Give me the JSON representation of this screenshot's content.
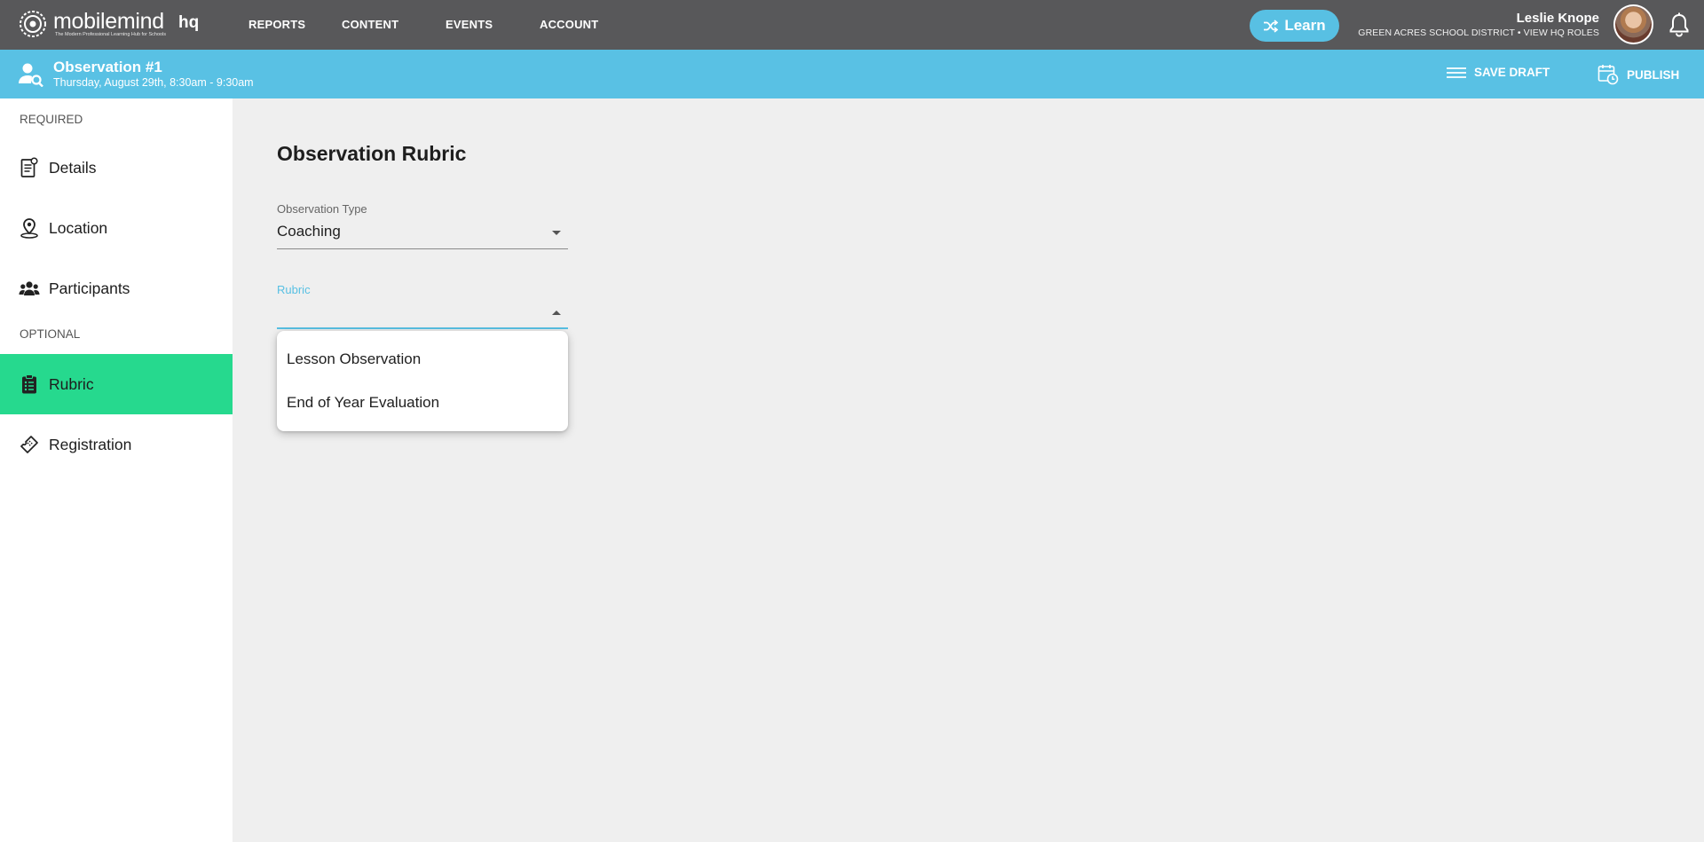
{
  "colors": {
    "topbar": "#58585a",
    "subbar": "#59c1e4",
    "accent_blue": "#58c0e3",
    "active_green": "#26d98e"
  },
  "brand": {
    "name_bold": "mobile",
    "name_light": "mind",
    "tagline": "The Modern Professional Learning Hub for Schools",
    "product": "hq"
  },
  "nav": {
    "items": [
      "REPORTS",
      "CONTENT",
      "EVENTS",
      "ACCOUNT"
    ]
  },
  "learn_button": {
    "label": "Learn",
    "icon": "shuffle-icon"
  },
  "user": {
    "name": "Leslie Knope",
    "subtitle": "GREEN ACRES SCHOOL DISTRICT • VIEW HQ ROLES"
  },
  "subheader": {
    "icon": "user-search-icon",
    "title": "Observation #1",
    "date": "Thursday, August 29th, 8:30am - 9:30am",
    "save_draft": "SAVE DRAFT",
    "publish": "PUBLISH"
  },
  "sidebar": {
    "required_label": "REQUIRED",
    "optional_label": "OPTIONAL",
    "items": [
      {
        "label": "Details",
        "icon": "document-icon"
      },
      {
        "label": "Location",
        "icon": "map-pin-icon"
      },
      {
        "label": "Participants",
        "icon": "people-icon"
      },
      {
        "label": "Rubric",
        "icon": "clipboard-list-icon",
        "active": true
      },
      {
        "label": "Registration",
        "icon": "ticket-icon"
      }
    ]
  },
  "main": {
    "title": "Observation Rubric",
    "observation_type": {
      "label": "Observation Type",
      "value": "Coaching"
    },
    "rubric": {
      "label": "Rubric",
      "value": "",
      "options": [
        "Lesson Observation",
        "End of Year Evaluation"
      ]
    }
  }
}
